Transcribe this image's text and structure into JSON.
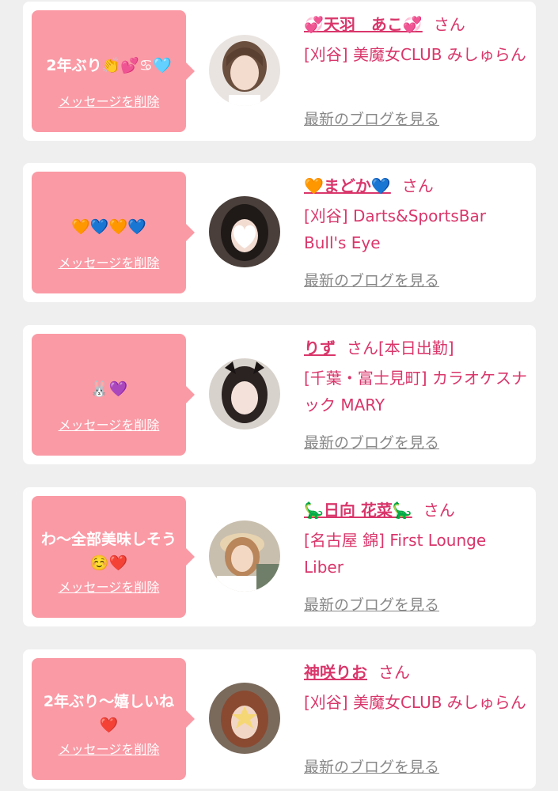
{
  "colors": {
    "page_background": "#efefef",
    "card_background": "#ffffff",
    "bubble_pink": "#fa9aa5",
    "name_pink": "#d9366b",
    "link_gray": "#888888"
  },
  "common": {
    "delete_label": "メッセージを削除",
    "blog_label": "最新のブログを見る",
    "honorific": "さん"
  },
  "cards": [
    {
      "message": "2年ぶり👏💕♋🩵",
      "name": "💞天羽　あこ💞",
      "status": "",
      "shop": "[刈谷] 美魔女CLUB みしゅらん",
      "avatar_icon": "avatar-photo"
    },
    {
      "message": "🧡💙🧡💙",
      "name": "🧡まどか💙",
      "status": "",
      "shop": "[刈谷] Darts&SportsBar Bull's Eye",
      "avatar_icon": "avatar-photo"
    },
    {
      "message": "🐰💜",
      "name": "りず",
      "status": "[本日出勤]",
      "shop": "[千葉・富士見町] カラオケスナック MARY",
      "avatar_icon": "avatar-photo"
    },
    {
      "message": "わ〜全部美味しそう☺️❤️",
      "name": "🦕日向 花菜🦕",
      "status": "",
      "shop": "[名古屋 錦] First Lounge Liber",
      "avatar_icon": "avatar-photo"
    },
    {
      "message": "2年ぶり〜嬉しいね❤️",
      "name": "神咲りお",
      "status": "",
      "shop": "[刈谷] 美魔女CLUB みしゅらん",
      "avatar_icon": "avatar-photo"
    }
  ]
}
